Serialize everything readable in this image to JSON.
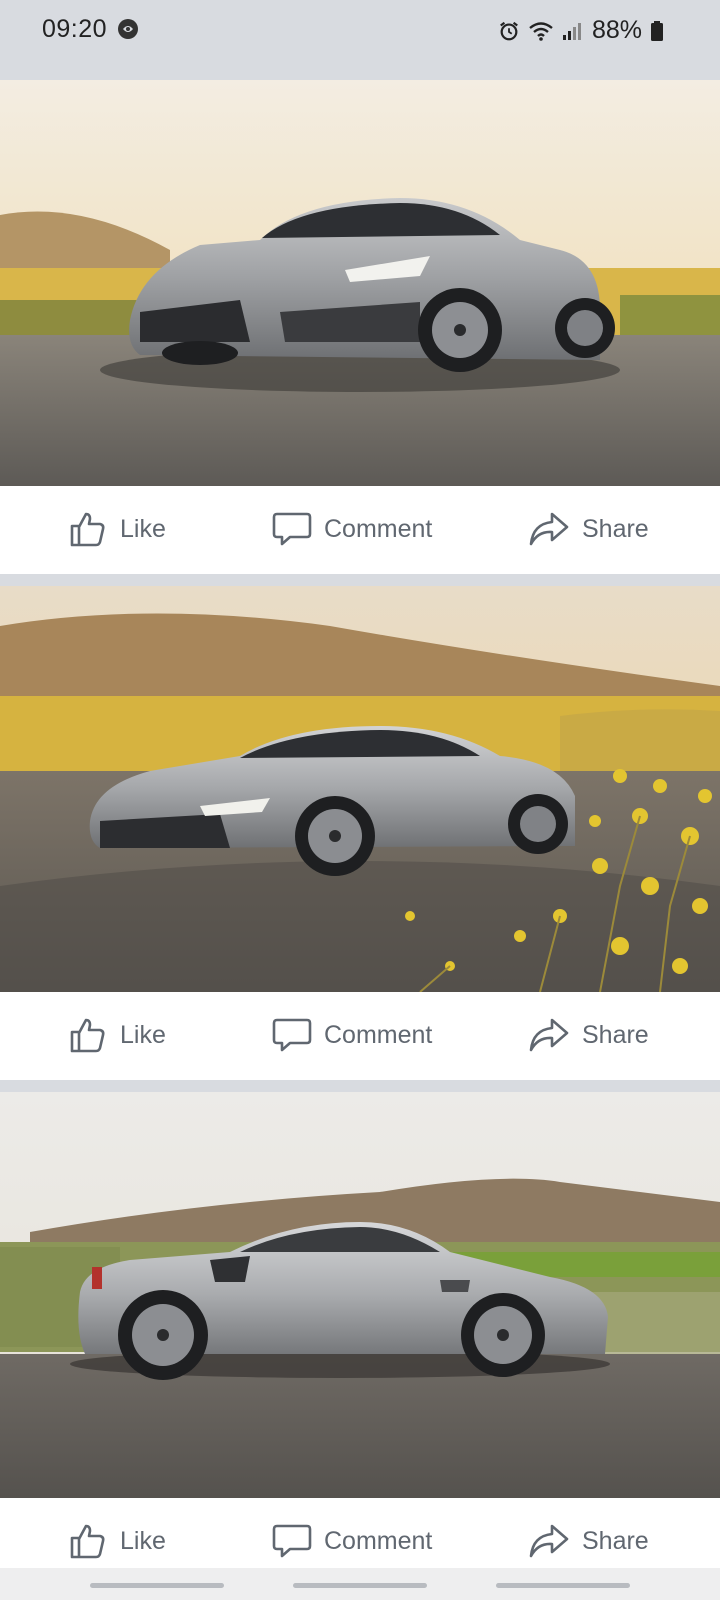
{
  "status_bar": {
    "time": "09:20",
    "battery": "88%",
    "icons": [
      "notification-icon",
      "alarm-icon",
      "wifi-icon",
      "signal-icon",
      "battery-icon"
    ]
  },
  "posts": [
    {
      "photo": "silver-ferrari-front-three-quarter",
      "actions": {
        "like": "Like",
        "comment": "Comment",
        "share": "Share"
      }
    },
    {
      "photo": "silver-ferrari-front-left-yellow-flowers",
      "actions": {
        "like": "Like",
        "comment": "Comment",
        "share": "Share"
      }
    },
    {
      "photo": "silver-ferrari-side-profile",
      "actions": {
        "like": "Like",
        "comment": "Comment",
        "share": "Share"
      }
    }
  ],
  "colors": {
    "action_text": "#606770",
    "separator": "#d8dbe0",
    "background": "#ffffff"
  }
}
